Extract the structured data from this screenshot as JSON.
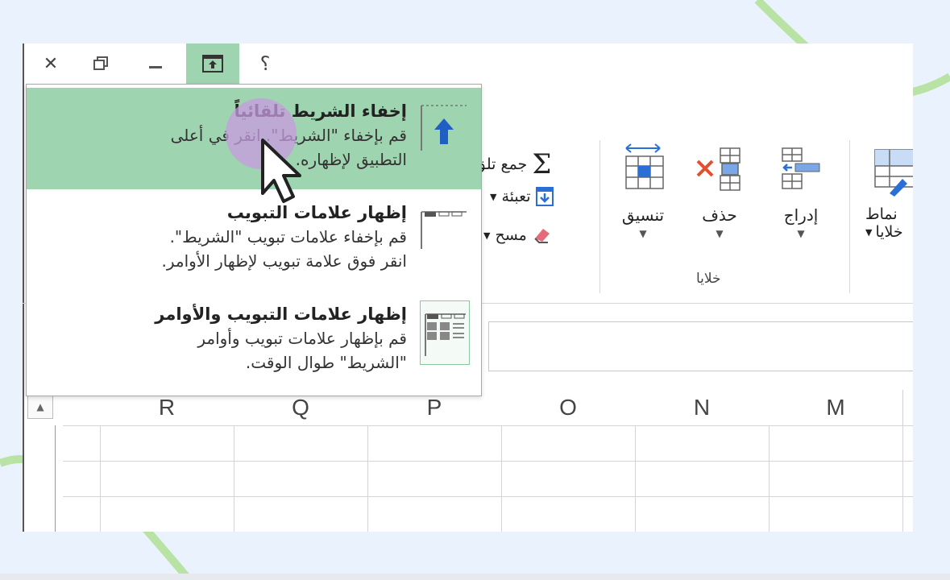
{
  "window": {
    "buttons": [
      {
        "name": "close",
        "glyph": "✕"
      },
      {
        "name": "restore",
        "glyph": "🗗"
      },
      {
        "name": "minimize",
        "glyph": "—"
      },
      {
        "name": "ribbon-display-options",
        "glyph": "⊼"
      },
      {
        "name": "help",
        "glyph": "؟"
      }
    ]
  },
  "ribbon": {
    "editing": {
      "autosum_label": "جمع تلق",
      "fill_label": "تعبئة",
      "clear_label": "مسح"
    },
    "cells": {
      "format_label": "تنسيق",
      "delete_label": "حذف",
      "insert_label": "إدراج",
      "group_label": "خلايا"
    },
    "styles": {
      "cell_styles_line1": "نماط",
      "cell_styles_line2": "خلايا"
    }
  },
  "ribbon_menu": {
    "items": [
      {
        "title": "إخفاء الشريط تلقائياً",
        "desc_lines": [
          "قم بإخفاء \"الشريط\". انقر في أعلى",
          "التطبيق لإظهاره."
        ],
        "selected": true
      },
      {
        "title": "إظهار علامات التبويب",
        "desc_lines": [
          "قم بإخفاء علامات تبويب \"الشريط\".",
          "انقر فوق علامة تبويب لإظهار الأوامر."
        ],
        "selected": false
      },
      {
        "title": "إظهار علامات التبويب والأوامر",
        "desc_lines": [
          "قم بإظهار علامات تبويب وأوامر",
          "\"الشريط\" طوال الوقت."
        ],
        "selected": false
      }
    ]
  },
  "sheet": {
    "columns": [
      "R",
      "Q",
      "P",
      "O",
      "N",
      "M"
    ]
  },
  "colors": {
    "background": "#eaf3fd",
    "accent_green": "#9fd4b0",
    "decor_green": "#b8e3a4",
    "cursor_highlight": "#c79be0",
    "arrow_blue": "#2a6fd6"
  }
}
